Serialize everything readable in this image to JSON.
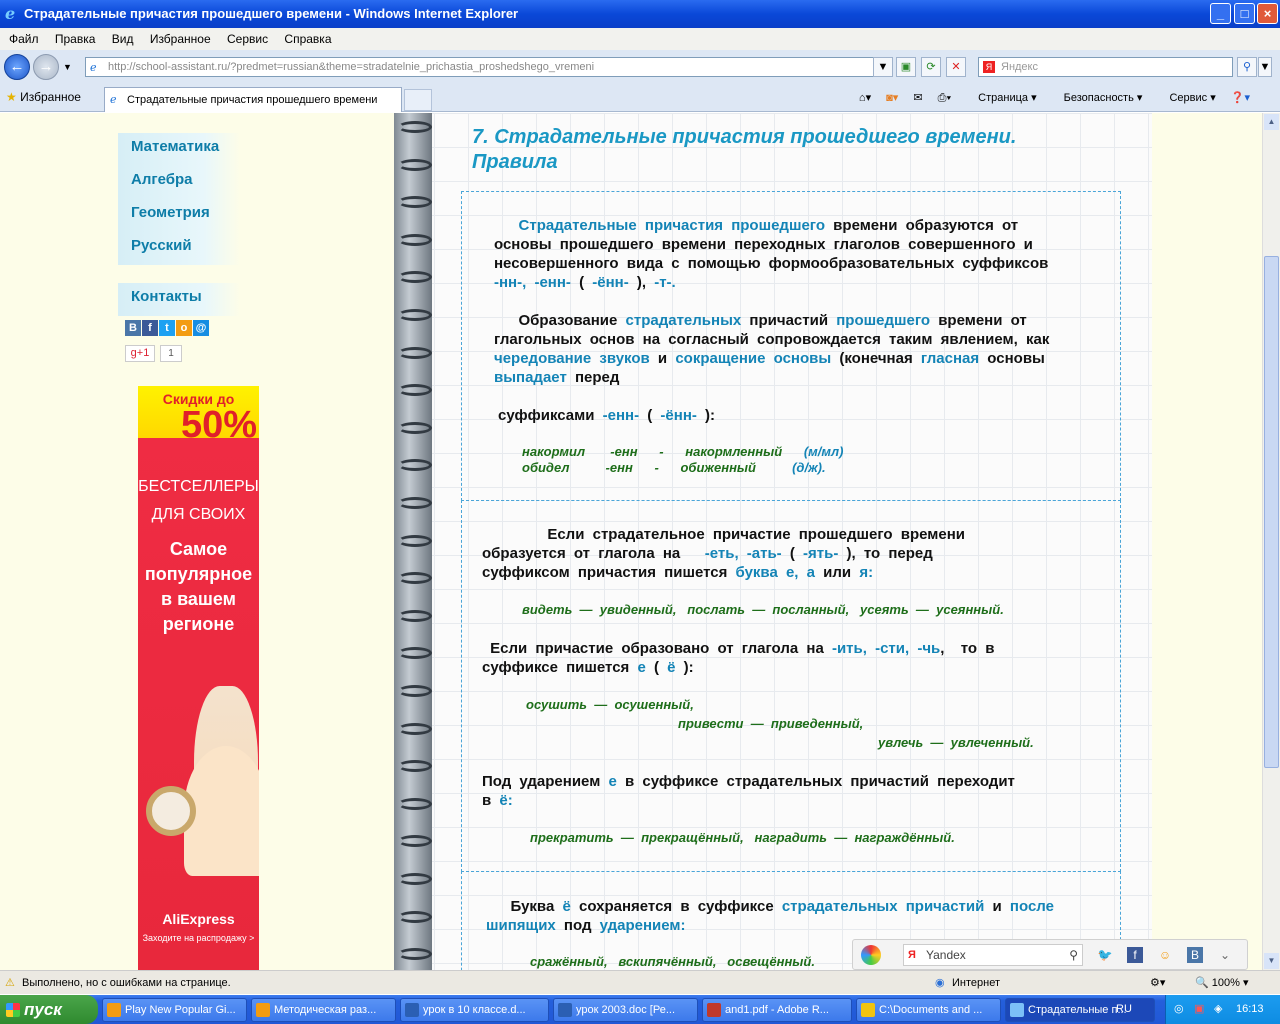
{
  "window": {
    "title": "Страдательные причастия прошедшего времени - Windows Internet Explorer"
  },
  "menubar": [
    "Файл",
    "Правка",
    "Вид",
    "Избранное",
    "Сервис",
    "Справка"
  ],
  "address": "http://school-assistant.ru/?predmet=russian&theme=stradatelnie_prichastia_proshedshego_vremeni",
  "search": {
    "placeholder": "Яндекс"
  },
  "favorites_label": "Избранное",
  "tab": {
    "title": "Страдательные причастия прошедшего времени"
  },
  "tools": [
    "Страница",
    "Безопасность",
    "Сервис"
  ],
  "sidebar": {
    "items": [
      {
        "label": "Математика"
      },
      {
        "label": "Алгебра"
      },
      {
        "label": "Геометрия"
      },
      {
        "label": "Русский"
      }
    ],
    "contacts": "Контакты",
    "gplus": "g+1",
    "gcount": "1"
  },
  "ad": {
    "line1": "Скидки до",
    "line2": "50%",
    "line3a": "БЕСТСЕЛЛЕРЫ",
    "line3b": "ДЛЯ СВОИХ",
    "line4a": "Самое",
    "line4b": "популярное",
    "line4c": "в вашем",
    "line4d": "регионе",
    "brand": "AliExpress",
    "cta": "Заходите на распродажу >"
  },
  "page": {
    "title1": "7. Страдательные причастия прошедшего времени.",
    "title2": "Правила"
  },
  "ydbar": {
    "text": "Yandex"
  },
  "status": {
    "text": "Выполнено, но с ошибками на странице.",
    "zone": "Интернет",
    "zoom": "100%"
  },
  "taskbar": {
    "start": "пуск",
    "items": [
      {
        "label": "Play New Popular Gi..."
      },
      {
        "label": "Методическая раз..."
      },
      {
        "label": "урок в 10 классе.d..."
      },
      {
        "label": "урок 2003.doc [Ре..."
      },
      {
        "label": "and1.pdf - Adobe R..."
      },
      {
        "label": "C:\\Documents and ..."
      },
      {
        "label": "Страдательные п..."
      }
    ],
    "lang": "RU",
    "time": "16:13"
  }
}
